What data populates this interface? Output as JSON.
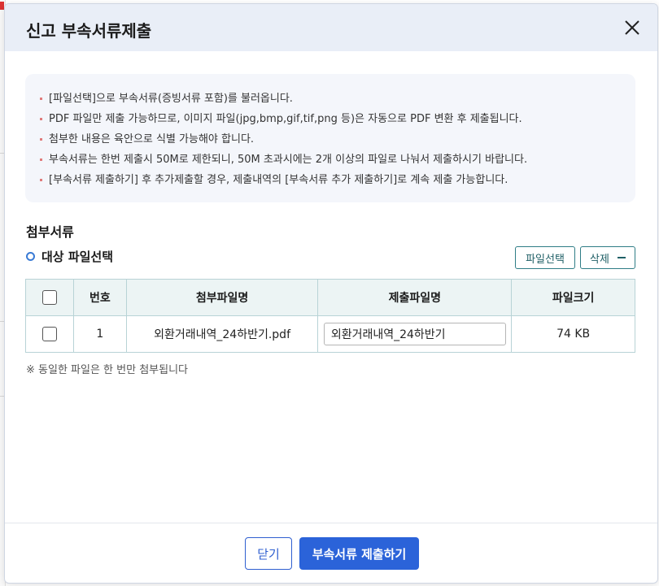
{
  "modal": {
    "title": "신고 부속서류제출",
    "close_icon": "close-icon"
  },
  "notice": {
    "items": [
      "[파일선택]으로 부속서류(증빙서류 포함)를 불러옵니다.",
      "PDF 파일만 제출 가능하므로, 이미지 파일(jpg,bmp,gif,tif,png 등)은 자동으로 PDF 변환 후 제출됩니다.",
      "첨부한 내용은 육안으로 식별 가능해야 합니다.",
      "부속서류는 한번 제출시 50M로 제한되니, 50M 초과시에는 2개 이상의 파일로 나눠서 제출하시기 바랍니다.",
      "[부속서류 제출하기] 후 추가제출할 경우, 제출내역의 [부속서류 추가 제출하기]로 계속 제출 가능합니다."
    ]
  },
  "attachments": {
    "section_title": "첨부서류",
    "sub_title": "대상 파일선택",
    "select_button": "파일선택",
    "delete_button": "삭제",
    "columns": [
      "번호",
      "첨부파일명",
      "제출파일명",
      "파일크기"
    ],
    "rows": [
      {
        "no": "1",
        "attached_name": "외환거래내역_24하반기.pdf",
        "submit_name": "외환거래내역_24하반기",
        "size": "74 KB"
      }
    ],
    "note": "※ 동일한 파일은 한 번만 첨부됩니다"
  },
  "footer": {
    "close_button": "닫기",
    "submit_button": "부속서류 제출하기"
  },
  "colors": {
    "header_bg": "#e9eef7",
    "primary": "#2b63d9",
    "teal_border": "#2f7d86"
  }
}
